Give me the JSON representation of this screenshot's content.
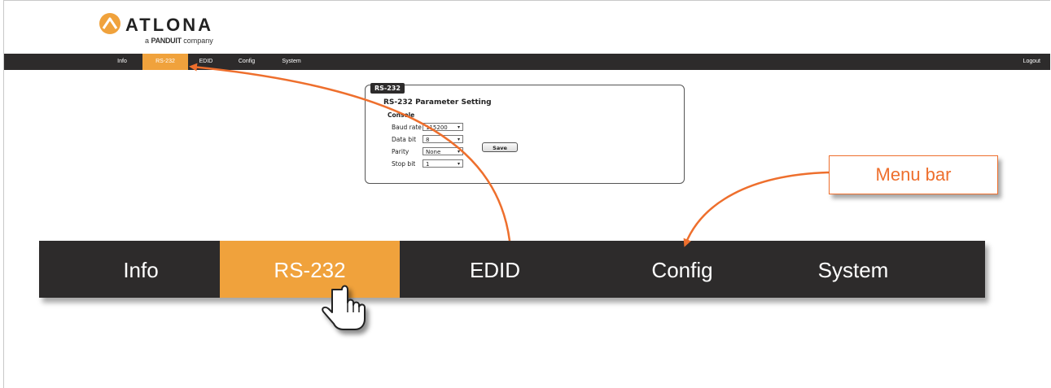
{
  "brand": {
    "name": "ATLONA",
    "tagline_prefix": "a",
    "tagline_brand": "PANDUIT",
    "tagline_suffix": "company",
    "accent": "#f0a23c",
    "callout_color": "#ee6f2d"
  },
  "topnav": {
    "items": [
      {
        "label": "Info"
      },
      {
        "label": "RS-232"
      },
      {
        "label": "EDID"
      },
      {
        "label": "Config"
      },
      {
        "label": "System"
      }
    ],
    "active": "RS-232",
    "logout": "Logout"
  },
  "panel": {
    "tab": "RS-232",
    "title": "RS-232 Parameter Setting",
    "section": "Console",
    "fields": [
      {
        "label": "Baud rate",
        "value": "115200"
      },
      {
        "label": "Data bit",
        "value": "8"
      },
      {
        "label": "Parity",
        "value": "None"
      },
      {
        "label": "Stop bit",
        "value": "1"
      }
    ],
    "save": "Save"
  },
  "bigbar": {
    "items": [
      {
        "label": "Info"
      },
      {
        "label": "RS-232"
      },
      {
        "label": "EDID"
      },
      {
        "label": "Config"
      },
      {
        "label": "System"
      }
    ],
    "active": "RS-232"
  },
  "callout": {
    "label": "Menu bar"
  },
  "icons": {
    "cursor": "hand-pointer-icon",
    "dropdown": "chevron-down-icon"
  }
}
